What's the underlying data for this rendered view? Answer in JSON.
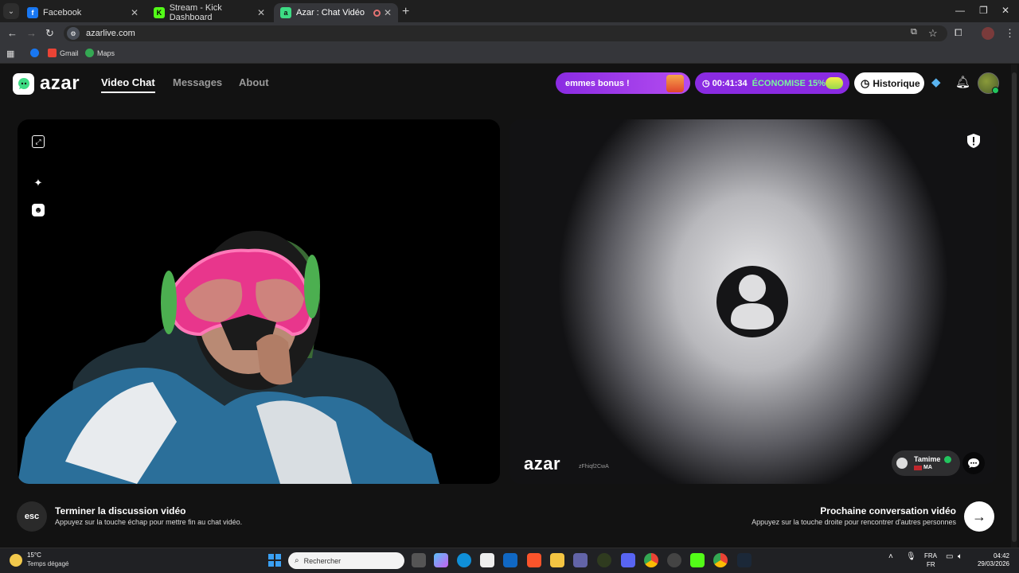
{
  "browser": {
    "tabs": [
      {
        "title": "Facebook",
        "favicon": "facebook-icon",
        "color": "#1877f2"
      },
      {
        "title": "Stream - Kick Dashboard",
        "favicon": "kick-icon",
        "color": "#53fc18"
      },
      {
        "title": "Azar : Chat Vidéo avec de n",
        "favicon": "azar-icon",
        "color": "#3ddc84",
        "active": true
      }
    ],
    "url": "azarlive.com",
    "bookmarks": [
      "Gmail",
      "Maps"
    ]
  },
  "header": {
    "logo_text": "azar",
    "nav": [
      "Video Chat",
      "Messages",
      "About"
    ],
    "bonus_label": "emmes bonus !",
    "timer_value": "00:41:34",
    "timer_promo": "ÉCONOMISE 15%",
    "history_label": "Historique"
  },
  "video": {
    "watermark_logo": "azar",
    "watermark_id": "zFhiqf2CwA",
    "peer_name": "Tamime",
    "peer_country": "MA"
  },
  "bottom": {
    "esc_key": "esc",
    "end_title": "Terminer la discussion vidéo",
    "end_subtitle": "Appuyez sur la touche échap pour mettre fin au chat vidéo.",
    "next_title": "Prochaine conversation vidéo",
    "next_subtitle": "Appuyez sur la touche droite pour rencontrer d'autres personnes",
    "next_arrow": "→"
  },
  "taskbar": {
    "temperature": "15°C",
    "weather": "Temps dégagé",
    "search_placeholder": "Rechercher",
    "lang_top": "FRA",
    "lang_bottom": "FR",
    "time": "04:42",
    "date": "29/03/2026"
  },
  "colors": {
    "brand_purple": "#8a2be2",
    "brand_green": "#3ddc84"
  }
}
